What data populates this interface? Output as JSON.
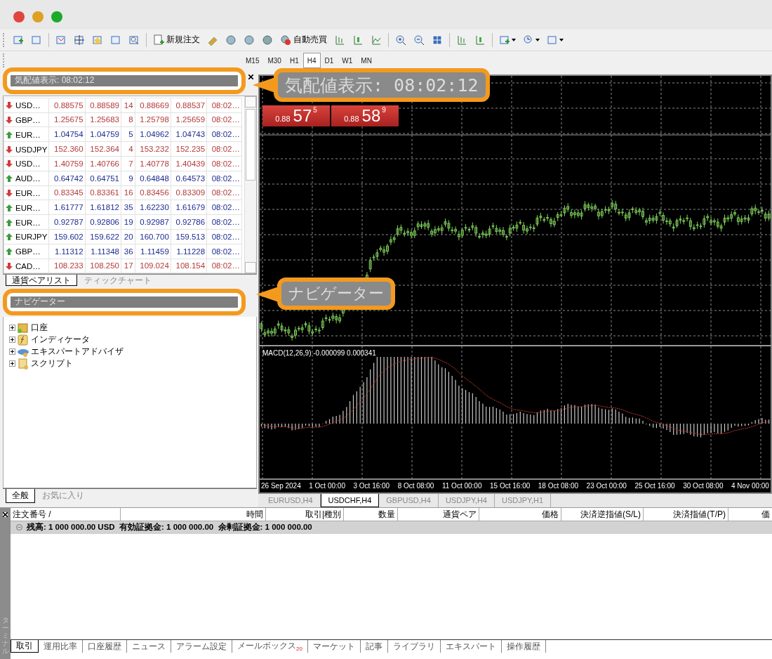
{
  "toolbar": {
    "buttons": [
      {
        "label": "新規注文"
      },
      {
        "label": "自動売買"
      }
    ]
  },
  "timeframes": [
    {
      "label": "M15",
      "selected": false
    },
    {
      "label": "M30",
      "selected": false
    },
    {
      "label": "H1",
      "selected": false
    },
    {
      "label": "H4",
      "selected": true
    },
    {
      "label": "D1",
      "selected": false
    },
    {
      "label": "W1",
      "selected": false
    },
    {
      "label": "MN",
      "selected": false
    }
  ],
  "market_watch": {
    "title": "気配値表示: 08:02:12",
    "rows": [
      {
        "symbol": "USD…",
        "bid": "0.88575",
        "ask": "0.88589",
        "spread": "14",
        "high": "0.88669",
        "low": "0.88537",
        "time": "08:02…",
        "rising": false
      },
      {
        "symbol": "GBP…",
        "bid": "1.25675",
        "ask": "1.25683",
        "spread": "8",
        "high": "1.25798",
        "low": "1.25659",
        "time": "08:02…",
        "rising": false
      },
      {
        "symbol": "EUR…",
        "bid": "1.04754",
        "ask": "1.04759",
        "spread": "5",
        "high": "1.04962",
        "low": "1.04743",
        "time": "08:02…",
        "rising": true
      },
      {
        "symbol": "USDJPY",
        "bid": "152.360",
        "ask": "152.364",
        "spread": "4",
        "high": "153.232",
        "low": "152.235",
        "time": "08:02…",
        "rising": false
      },
      {
        "symbol": "USD…",
        "bid": "1.40759",
        "ask": "1.40766",
        "spread": "7",
        "high": "1.40778",
        "low": "1.40439",
        "time": "08:02…",
        "rising": false
      },
      {
        "symbol": "AUD…",
        "bid": "0.64742",
        "ask": "0.64751",
        "spread": "9",
        "high": "0.64848",
        "low": "0.64573",
        "time": "08:02…",
        "rising": true
      },
      {
        "symbol": "EUR…",
        "bid": "0.83345",
        "ask": "0.83361",
        "spread": "16",
        "high": "0.83456",
        "low": "0.83309",
        "time": "08:02…",
        "rising": false
      },
      {
        "symbol": "EUR…",
        "bid": "1.61777",
        "ask": "1.61812",
        "spread": "35",
        "high": "1.62230",
        "low": "1.61679",
        "time": "08:02…",
        "rising": true
      },
      {
        "symbol": "EUR…",
        "bid": "0.92787",
        "ask": "0.92806",
        "spread": "19",
        "high": "0.92987",
        "low": "0.92786",
        "time": "08:02…",
        "rising": true
      },
      {
        "symbol": "EURJPY",
        "bid": "159.602",
        "ask": "159.622",
        "spread": "20",
        "high": "160.700",
        "low": "159.513",
        "time": "08:02…",
        "rising": true
      },
      {
        "symbol": "GBP…",
        "bid": "1.11312",
        "ask": "1.11348",
        "spread": "36",
        "high": "1.11459",
        "low": "1.11228",
        "time": "08:02…",
        "rising": true
      },
      {
        "symbol": "CAD…",
        "bid": "108.233",
        "ask": "108.250",
        "spread": "17",
        "high": "109.024",
        "low": "108.154",
        "time": "08:02…",
        "rising": false
      }
    ],
    "tabs": [
      {
        "label": "通貨ペアリスト",
        "selected": true
      },
      {
        "label": "ティックチャート",
        "selected": false
      }
    ]
  },
  "navigator": {
    "title": "ナビゲーター",
    "items": [
      {
        "label": "口座",
        "kind": "account",
        "expanded": false
      },
      {
        "label": "インディケータ",
        "kind": "indicator",
        "expanded": false
      },
      {
        "label": "エキスパートアドバイザ",
        "kind": "expert",
        "expanded": false
      },
      {
        "label": "スクリプト",
        "kind": "script",
        "expanded": false
      }
    ],
    "tabs": [
      {
        "label": "全般",
        "selected": true
      },
      {
        "label": "お気に入り",
        "selected": false
      }
    ]
  },
  "chart": {
    "quotes": [
      {
        "prefix": "0.88",
        "big": "57",
        "sup": "5"
      },
      {
        "prefix": "0.88",
        "big": "58",
        "sup": "9"
      }
    ],
    "indicator_label": "MACD(12,26,9) -0.000099 0.000341",
    "time_labels": [
      "26 Sep 2024",
      "1 Oct 00:00",
      "3 Oct 16:00",
      "8 Oct 08:00",
      "11 Oct 00:00",
      "15 Oct 16:00",
      "18 Oct 08:00",
      "23 Oct 00:00",
      "25 Oct 16:00",
      "30 Oct 08:00",
      "4 Nov 00:00"
    ],
    "tabs": [
      {
        "label": "EURUSD,H4",
        "selected": false
      },
      {
        "label": "USDCHF,H4",
        "selected": true
      },
      {
        "label": "GBPUSD,H4",
        "selected": false
      },
      {
        "label": "USDJPY,H4",
        "selected": false
      },
      {
        "label": "USDJPY,H1",
        "selected": false
      }
    ]
  },
  "callouts": [
    {
      "text": "気配値表示: 08:02:12"
    },
    {
      "text": "ナビゲーター"
    }
  ],
  "terminal": {
    "side_label": "ターミナル",
    "columns": [
      "注文番号 /",
      "時間",
      "取引|種別",
      "数量",
      "通貨ペア",
      "価格",
      "決済逆指値(S/L)",
      "決済指値(T/P)",
      "価"
    ],
    "balance": "残高: 1 000 000.00 USD  有効証拠金: 1 000 000.00  余剰証拠金: 1 000 000.00",
    "tabs": [
      {
        "label": "取引",
        "selected": true
      },
      {
        "label": "運用比率",
        "selected": false
      },
      {
        "label": "口座履歴",
        "selected": false
      },
      {
        "label": "ニュース",
        "selected": false
      },
      {
        "label": "アラーム設定",
        "selected": false
      },
      {
        "label": "メールボックス",
        "badge": "20",
        "selected": false
      },
      {
        "label": "マーケット",
        "selected": false
      },
      {
        "label": "記事",
        "selected": false
      },
      {
        "label": "ライブラリ",
        "selected": false
      },
      {
        "label": "エキスパート",
        "selected": false
      },
      {
        "label": "操作履歴",
        "selected": false
      }
    ]
  }
}
